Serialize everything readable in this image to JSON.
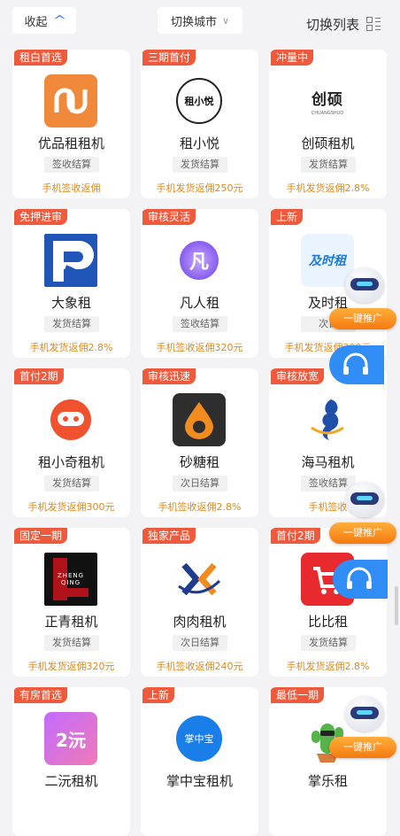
{
  "topbar": {
    "collapse_label": "收起",
    "city_label": "切换城市",
    "switch_list_label": "切换列表"
  },
  "cards": [
    {
      "tag": "租白首选",
      "name": "优品租租机",
      "settle": "签收结算",
      "rebate": "手机签收返佣",
      "logo_text": ""
    },
    {
      "tag": "三期首付",
      "name": "租小悦",
      "settle": "发货结算",
      "rebate": "手机发货返佣250元",
      "logo_text": "租小悦"
    },
    {
      "tag": "冲量中",
      "name": "创硕租机",
      "settle": "发货结算",
      "rebate": "手机发货返佣2.8%",
      "logo_text": "创硕"
    },
    {
      "tag": "免押进审",
      "name": "大象租",
      "settle": "发货结算",
      "rebate": "手机发货返佣2.8%",
      "logo_text": ""
    },
    {
      "tag": "审核灵活",
      "name": "凡人租",
      "settle": "签收结算",
      "rebate": "手机签收返佣320元",
      "logo_text": "凡"
    },
    {
      "tag": "上新",
      "name": "及时租",
      "settle": "次日",
      "rebate": "手机发货返佣300元",
      "logo_text": "及时租"
    },
    {
      "tag": "首付2期",
      "name": "租小奇租机",
      "settle": "发货结算",
      "rebate": "手机发货返佣300元",
      "logo_text": ""
    },
    {
      "tag": "审核迅速",
      "name": "砂糖租",
      "settle": "次日结算",
      "rebate": "手机签收返佣2.8%",
      "logo_text": ""
    },
    {
      "tag": "审核放宽",
      "name": "海马租机",
      "settle": "签收结算",
      "rebate": "手机签收",
      "logo_text": ""
    },
    {
      "tag": "固定一期",
      "name": "正青租机",
      "settle": "发货结算",
      "rebate": "手机发货返佣320元",
      "logo_text": "ZHENG QING"
    },
    {
      "tag": "独家产品",
      "name": "肉肉租机",
      "settle": "次日结算",
      "rebate": "手机签收返佣240元",
      "logo_text": "K"
    },
    {
      "tag": "首付2期",
      "name": "比比租",
      "settle": "发货结算",
      "rebate": "手机发货返佣2.8%",
      "logo_text": ""
    },
    {
      "tag": "有房首选",
      "name": "二沅租机",
      "settle": "",
      "rebate": "",
      "logo_text": "2沅"
    },
    {
      "tag": "上新",
      "name": "掌中宝租机",
      "settle": "",
      "rebate": "",
      "logo_text": "掌中宝"
    },
    {
      "tag": "最低一期",
      "name": "掌乐租",
      "settle": "",
      "rebate": "",
      "logo_text": ""
    }
  ],
  "promo": {
    "label": "一键推广"
  },
  "colors": {
    "tag_bg": "#f05a3c",
    "rebate": "#e08a1f",
    "accent_blue": "#2f8df5",
    "promo_orange": "#f57a10"
  }
}
